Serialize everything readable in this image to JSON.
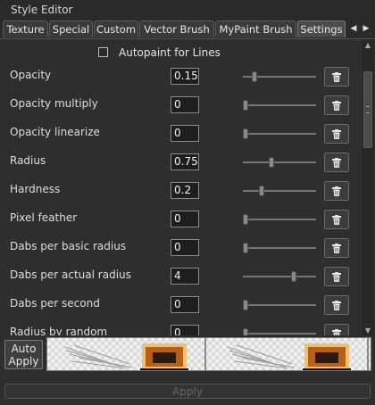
{
  "window": {
    "title": "Style Editor"
  },
  "tabs": [
    {
      "label": "Texture",
      "active": false
    },
    {
      "label": "Special",
      "active": false
    },
    {
      "label": "Custom",
      "active": false
    },
    {
      "label": "Vector Brush",
      "active": false
    },
    {
      "label": "MyPaint Brush",
      "active": false
    },
    {
      "label": "Settings",
      "active": true
    }
  ],
  "autopaint": {
    "label": "Autopaint for Lines",
    "checked": false
  },
  "params": [
    {
      "label": "Opacity",
      "value": "0.15",
      "slider": 0.12
    },
    {
      "label": "Opacity multiply",
      "value": "0",
      "slider": 0.0
    },
    {
      "label": "Opacity linearize",
      "value": "0",
      "slider": 0.0
    },
    {
      "label": "Radius",
      "value": "0.75",
      "slider": 0.35
    },
    {
      "label": "Hardness",
      "value": "0.2",
      "slider": 0.22
    },
    {
      "label": "Pixel feather",
      "value": "0",
      "slider": 0.0
    },
    {
      "label": "Dabs per basic radius",
      "value": "0",
      "slider": 0.0
    },
    {
      "label": "Dabs per actual radius",
      "value": "4",
      "slider": 0.66
    },
    {
      "label": "Dabs per second",
      "value": "0",
      "slider": 0.0
    },
    {
      "label": "Radius by random",
      "value": "0",
      "slider": 0.0
    }
  ],
  "bottom": {
    "auto_apply_label": "Auto Apply",
    "apply_label": "Apply"
  },
  "icons": {
    "trash": "trash-icon",
    "left": "chevron-left-icon",
    "right": "chevron-right-icon"
  }
}
